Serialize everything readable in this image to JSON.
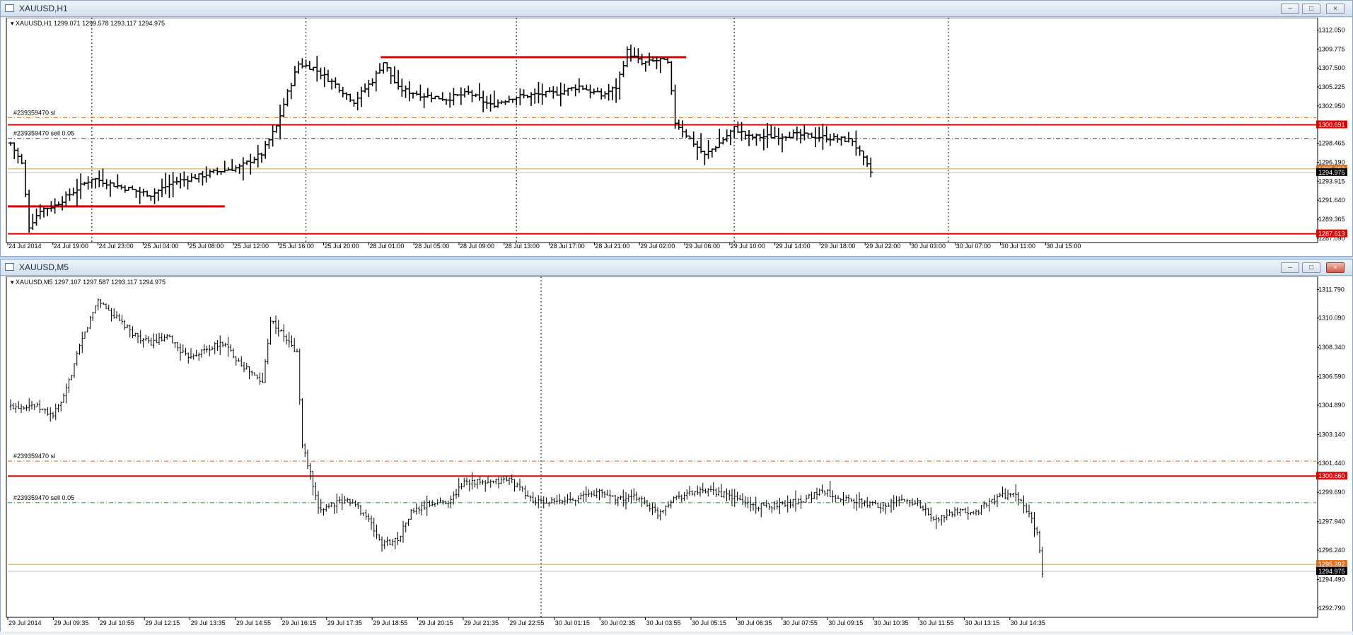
{
  "colors": {
    "bull": "#000000",
    "level": "#dd0000",
    "sl": "#d2691e",
    "tp": "#228b22",
    "grid": "#000000",
    "bid": "#c8a050"
  },
  "windows": [
    {
      "title": "XAUUSD,H1",
      "info": "XAUUSD,H1  1299.071 1299.578 1293.117 1294.975",
      "close_active": false,
      "order_sl_label": "#239359470 sl",
      "order_sell_label": "#239359470 sell 0.05",
      "price_labels": [
        "1312.050",
        "1309.775",
        "1307.500",
        "1305.225",
        "1302.950",
        "1300.675",
        "1298.465",
        "1296.190",
        "1293.915",
        "1291.640",
        "1289.365",
        "1287.090"
      ],
      "price_range": [
        1286.9,
        1313.2
      ],
      "time_labels": [
        "24 Jul 2014",
        "24 Jul 19:00",
        "24 Jul 23:00",
        "25 Jul 04:00",
        "25 Jul 08:00",
        "25 Jul 12:00",
        "25 Jul 16:00",
        "25 Jul 20:00",
        "28 Jul 01:00",
        "28 Jul 05:00",
        "28 Jul 09:00",
        "28 Jul 13:00",
        "28 Jul 17:00",
        "28 Jul 21:00",
        "29 Jul 02:00",
        "29 Jul 06:00",
        "29 Jul 10:00",
        "29 Jul 14:00",
        "29 Jul 18:00",
        "29 Jul 22:00",
        "30 Jul 03:00",
        "30 Jul 07:00",
        "30 Jul 11:00",
        "30 Jul 15:00"
      ],
      "badges": [
        {
          "text": "1300.691",
          "value": 1300.691,
          "bg": "#dd0000"
        },
        {
          "text": "1295.392",
          "value": 1295.392,
          "bg": "#e07020"
        },
        {
          "text": "1294.975",
          "value": 1294.975,
          "bg": "#000000"
        },
        {
          "text": "1287.613",
          "value": 1287.613,
          "bg": "#dd0000"
        }
      ],
      "levels": {
        "sl": 1301.55,
        "sell": 1299.071,
        "red_h": 1300.691,
        "bid": 1295.392,
        "low_red": 1287.613,
        "ask": 1294.975
      },
      "segments": [
        {
          "from_bar": 0,
          "to_bar": 58,
          "price": 1290.9
        },
        {
          "from_bar": 101,
          "to_bar": 183,
          "price": 1308.8
        }
      ],
      "chart_data": {
        "type": "ohlc",
        "series": [
          {
            "name": "XAUUSD,H1",
            "anchors": [
              [
                0,
                1298.5
              ],
              [
                3,
                1296.0
              ],
              [
                5,
                1288.5
              ],
              [
                8,
                1290.5
              ],
              [
                12,
                1291.0
              ],
              [
                18,
                1293.0
              ],
              [
                22,
                1294.3
              ],
              [
                30,
                1293.2
              ],
              [
                38,
                1292.3
              ],
              [
                44,
                1293.8
              ],
              [
                50,
                1294.4
              ],
              [
                55,
                1295.0
              ],
              [
                62,
                1295.6
              ],
              [
                68,
                1297.2
              ],
              [
                72,
                1300.5
              ],
              [
                75,
                1304.5
              ],
              [
                78,
                1308.0
              ],
              [
                82,
                1307.5
              ],
              [
                88,
                1305.5
              ],
              [
                93,
                1303.5
              ],
              [
                98,
                1306.0
              ],
              [
                101,
                1308.2
              ],
              [
                105,
                1305.0
              ],
              [
                112,
                1304.2
              ],
              [
                118,
                1303.8
              ],
              [
                124,
                1304.5
              ],
              [
                130,
                1303.0
              ],
              [
                136,
                1304.0
              ],
              [
                142,
                1304.3
              ],
              [
                148,
                1304.5
              ],
              [
                154,
                1305.3
              ],
              [
                160,
                1304.2
              ],
              [
                164,
                1305.2
              ],
              [
                167,
                1309.5
              ],
              [
                171,
                1308.0
              ],
              [
                176,
                1308.5
              ],
              [
                178,
                1308.0
              ],
              [
                180,
                1301.0
              ],
              [
                183,
                1299.5
              ],
              [
                188,
                1297.0
              ],
              [
                192,
                1298.5
              ],
              [
                196,
                1300.3
              ],
              [
                200,
                1299.2
              ],
              [
                206,
                1299.3
              ],
              [
                212,
                1299.5
              ],
              [
                218,
                1299.3
              ],
              [
                224,
                1299.0
              ],
              [
                228,
                1298.8
              ],
              [
                233,
                1295.0
              ]
            ]
          }
        ]
      },
      "vgrid_bars": [
        22,
        80,
        137,
        196,
        254
      ]
    },
    {
      "title": "XAUUSD,M5",
      "info": "XAUUSD,M5  1297.107 1297.587 1293.117 1294.975",
      "close_active": true,
      "order_sl_label": "#239359470 sl",
      "order_sell_label": "#239359470 sell 0.05",
      "price_labels": [
        "1311.790",
        "1310.090",
        "1308.340",
        "1306.590",
        "1304.890",
        "1303.140",
        "1301.440",
        "1299.690",
        "1297.940",
        "1296.240",
        "1294.490",
        "1292.790"
      ],
      "price_range": [
        1292.4,
        1312.4
      ],
      "time_labels": [
        "29 Jul 2014",
        "29 Jul 09:35",
        "29 Jul 10:55",
        "29 Jul 12:15",
        "29 Jul 13:35",
        "29 Jul 14:55",
        "29 Jul 16:15",
        "29 Jul 17:35",
        "29 Jul 18:55",
        "29 Jul 20:15",
        "29 Jul 21:35",
        "29 Jul 22:55",
        "30 Jul 01:15",
        "30 Jul 02:35",
        "30 Jul 03:55",
        "30 Jul 05:15",
        "30 Jul 06:35",
        "30 Jul 07:55",
        "30 Jul 09:15",
        "30 Jul 10:35",
        "30 Jul 11:55",
        "30 Jul 13:15",
        "30 Jul 14:35"
      ],
      "badges": [
        {
          "text": "1300.660",
          "value": 1300.66,
          "bg": "#dd0000"
        },
        {
          "text": "1295.392",
          "value": 1295.392,
          "bg": "#e07020"
        },
        {
          "text": "1294.975",
          "value": 1294.975,
          "bg": "#000000"
        }
      ],
      "levels": {
        "sl": 1301.55,
        "sell": 1299.071,
        "red_h": 1300.66,
        "bid": 1295.392,
        "ask": 1294.975
      },
      "segments": [],
      "chart_data": {
        "type": "ohlc",
        "series": [
          {
            "name": "XAUUSD,M5",
            "anchors": [
              [
                0,
                1304.8
              ],
              [
                8,
                1304.9
              ],
              [
                16,
                1304.3
              ],
              [
                20,
                1305.3
              ],
              [
                27,
                1308.8
              ],
              [
                33,
                1311.2
              ],
              [
                39,
                1310.2
              ],
              [
                45,
                1309.3
              ],
              [
                52,
                1308.6
              ],
              [
                60,
                1308.9
              ],
              [
                66,
                1307.8
              ],
              [
                72,
                1308.1
              ],
              [
                80,
                1308.6
              ],
              [
                88,
                1307.2
              ],
              [
                95,
                1306.2
              ],
              [
                98,
                1310.0
              ],
              [
                104,
                1308.8
              ],
              [
                108,
                1308.0
              ],
              [
                110,
                1302.5
              ],
              [
                113,
                1300.8
              ],
              [
                116,
                1298.6
              ],
              [
                121,
                1299.0
              ],
              [
                128,
                1299.2
              ],
              [
                134,
                1298.3
              ],
              [
                140,
                1296.6
              ],
              [
                146,
                1296.9
              ],
              [
                151,
                1298.5
              ],
              [
                158,
                1299.0
              ],
              [
                166,
                1299.2
              ],
              [
                171,
                1300.4
              ],
              [
                180,
                1300.2
              ],
              [
                188,
                1300.5
              ],
              [
                194,
                1299.6
              ],
              [
                198,
                1299.1
              ],
              [
                206,
                1299.1
              ],
              [
                214,
                1299.4
              ],
              [
                222,
                1299.7
              ],
              [
                230,
                1299.3
              ],
              [
                237,
                1299.4
              ],
              [
                244,
                1298.4
              ],
              [
                250,
                1299.4
              ],
              [
                258,
                1299.7
              ],
              [
                266,
                1299.7
              ],
              [
                274,
                1299.3
              ],
              [
                282,
                1298.8
              ],
              [
                290,
                1299.0
              ],
              [
                298,
                1299.2
              ],
              [
                306,
                1299.8
              ],
              [
                312,
                1299.4
              ],
              [
                320,
                1299.1
              ],
              [
                328,
                1298.9
              ],
              [
                336,
                1299.2
              ],
              [
                342,
                1299.1
              ],
              [
                348,
                1298.0
              ],
              [
                356,
                1298.5
              ],
              [
                364,
                1298.5
              ],
              [
                372,
                1299.4
              ],
              [
                377,
                1299.6
              ],
              [
                381,
                1299.2
              ],
              [
                385,
                1298.0
              ],
              [
                387,
                1297.3
              ],
              [
                389,
                1294.9
              ]
            ]
          }
        ]
      },
      "vgrid_bars": [
        200
      ]
    }
  ]
}
